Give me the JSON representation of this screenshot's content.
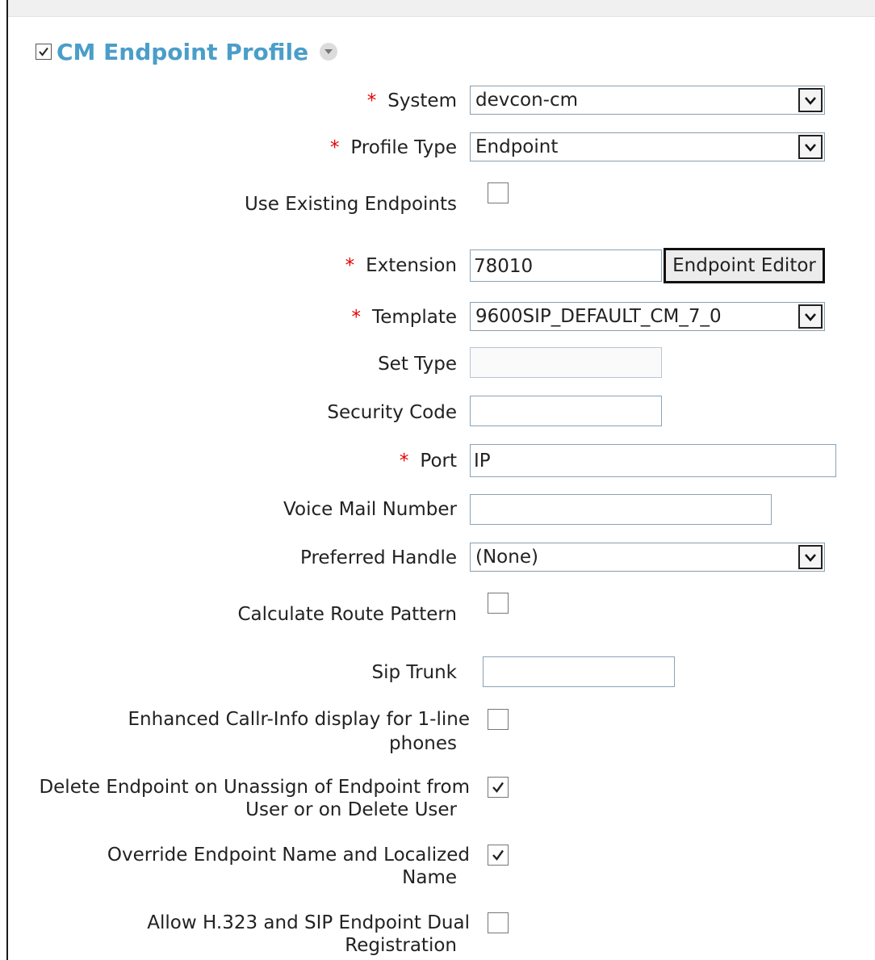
{
  "section": {
    "title": "CM Endpoint Profile",
    "checked": true,
    "menu_icon": "dropdown-arrow-icon"
  },
  "required_marker": "*",
  "fields": {
    "system": {
      "label": "System",
      "value": "devcon-cm",
      "required": true
    },
    "profile_type": {
      "label": "Profile Type",
      "value": "Endpoint",
      "required": true
    },
    "use_existing_endpoints": {
      "label": "Use Existing Endpoints",
      "checked": false
    },
    "extension": {
      "label": "Extension",
      "value": "78010",
      "required": true,
      "button_label": "Endpoint Editor"
    },
    "template": {
      "label": "Template",
      "value": "9600SIP_DEFAULT_CM_7_0",
      "required": true
    },
    "set_type": {
      "label": "Set Type",
      "value": ""
    },
    "security_code": {
      "label": "Security Code",
      "value": ""
    },
    "port": {
      "label": "Port",
      "value": "IP",
      "required": true
    },
    "voice_mail_number": {
      "label": "Voice Mail Number",
      "value": ""
    },
    "preferred_handle": {
      "label": "Preferred Handle",
      "value": "(None)"
    },
    "calculate_route_pattern": {
      "label": "Calculate Route Pattern",
      "checked": false
    },
    "sip_trunk": {
      "label": "Sip Trunk",
      "value": ""
    },
    "enhanced_callr_info": {
      "label_line1": "Enhanced Callr-Info display for 1-line",
      "label_line2": "phones",
      "checked": false
    },
    "delete_endpoint": {
      "label_line1": "Delete Endpoint on Unassign of Endpoint from",
      "label_line2": "User or on Delete User",
      "checked": true
    },
    "override_endpoint_name": {
      "label_line1": "Override Endpoint Name and Localized",
      "label_line2": "Name",
      "checked": true
    },
    "allow_dual_registration": {
      "label_line1": "Allow H.323 and SIP Endpoint Dual",
      "label_line2": "Registration",
      "checked": false
    }
  },
  "colors": {
    "title": "#4a9ec9",
    "required": "#e60000",
    "field_border": "#8a9eae"
  }
}
